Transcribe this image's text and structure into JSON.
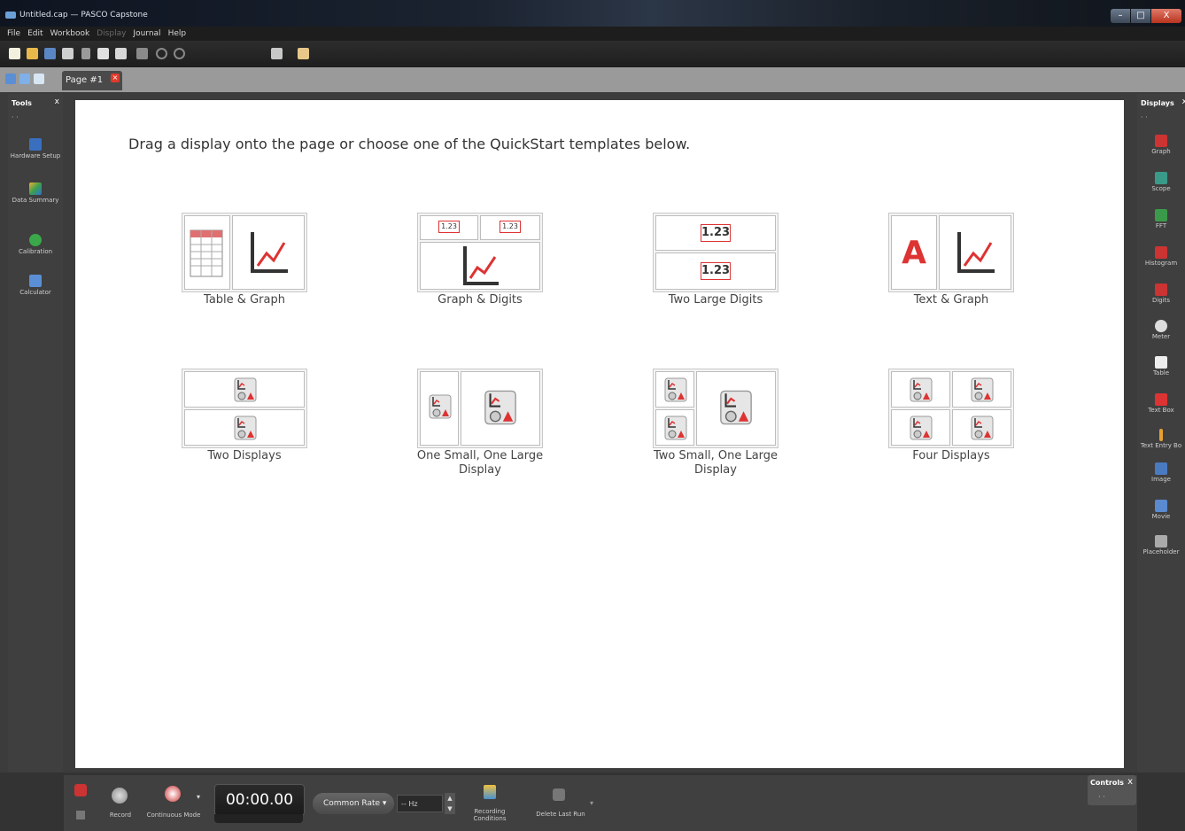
{
  "window": {
    "title": "Untitled.cap — PASCO Capstone",
    "buttons": [
      "–",
      "□",
      "X"
    ]
  },
  "menu": [
    "File",
    "Edit",
    "Workbook",
    "Display",
    "Journal",
    "Help"
  ],
  "tab": {
    "label": "Page #1"
  },
  "tools_panel": {
    "title": "Tools",
    "close": "x",
    "dots": "· ·",
    "items": [
      {
        "label": "Hardware Setup",
        "icon": "hardware-icon"
      },
      {
        "label": "Data Summary",
        "icon": "data-summary-icon"
      },
      {
        "label": "Calibration",
        "icon": "calibration-icon"
      },
      {
        "label": "Calculator",
        "icon": "calculator-icon"
      }
    ]
  },
  "displays_panel": {
    "title": "Displays",
    "close": "x",
    "dots": "· ·",
    "items": [
      {
        "label": "Graph",
        "icon": "graph-icon"
      },
      {
        "label": "Scope",
        "icon": "scope-icon"
      },
      {
        "label": "FFT",
        "icon": "fft-icon"
      },
      {
        "label": "Histogram",
        "icon": "histogram-icon"
      },
      {
        "label": "Digits",
        "icon": "digits-icon"
      },
      {
        "label": "Meter",
        "icon": "meter-icon"
      },
      {
        "label": "Table",
        "icon": "table-icon"
      },
      {
        "label": "Text Box",
        "icon": "text-box-icon"
      },
      {
        "label": "Text Entry Bo",
        "icon": "text-entry-icon"
      },
      {
        "label": "Image",
        "icon": "image-icon"
      },
      {
        "label": "Movie",
        "icon": "movie-icon"
      },
      {
        "label": "Placeholder",
        "icon": "placeholder-icon"
      }
    ]
  },
  "page": {
    "instruction": "Drag a display onto the page or choose one of the QuickStart templates below.",
    "templates": [
      {
        "label": "Table & Graph"
      },
      {
        "label": "Graph & Digits",
        "digits": "1.23"
      },
      {
        "label": "Two Large Digits",
        "digits": "1.23"
      },
      {
        "label": "Text & Graph",
        "text_glyph": "A"
      },
      {
        "label": "Two Displays"
      },
      {
        "label": "One Small, One Large Display"
      },
      {
        "label": "Two Small, One Large Display"
      },
      {
        "label": "Four Displays"
      }
    ]
  },
  "controls": {
    "record": "Record",
    "continuous_mode": "Continuous Mode",
    "timer": "00:00.00",
    "common_rate": "Common Rate",
    "rate_value": "-- Hz",
    "recording_conditions": "Recording Conditions",
    "delete_last_run": "Delete Last Run",
    "panel_title": "Controls",
    "panel_close": "x",
    "panel_dots": "· ·"
  }
}
